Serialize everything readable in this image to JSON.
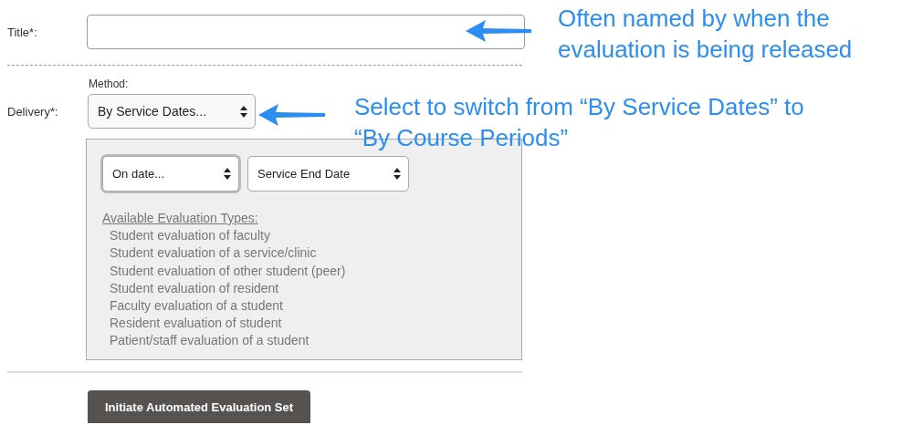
{
  "title_field": {
    "label": "Title*:"
  },
  "delivery": {
    "label": "Delivery*:",
    "method_label": "Method:",
    "method_value": "By Service Dates...",
    "timing_value": "On date...",
    "date_value": "Service End Date",
    "types_heading": "Available Evaluation Types:",
    "types": [
      "Student evaluation of faculty",
      "Student evaluation of a service/clinic",
      "Student evaluation of other student (peer)",
      "Student evaluation of resident",
      "Faculty evaluation of a student",
      "Resident evaluation of student",
      "Patient/staff evaluation of a student"
    ]
  },
  "button": "Initiate Automated Evaluation Set",
  "callouts": [
    "Often named by when the evaluation is being released",
    "Select to switch from “By Service Dates” to “By Course Periods”"
  ]
}
